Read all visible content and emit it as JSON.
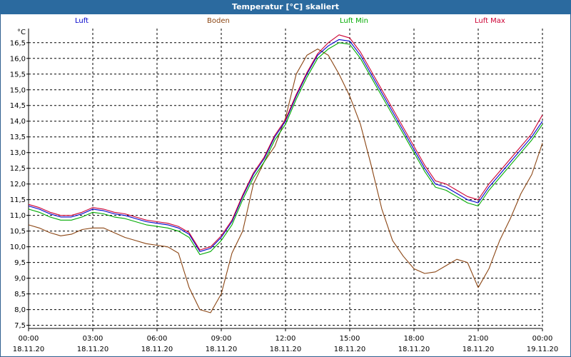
{
  "chart_data": {
    "type": "line",
    "title": "Temperatur [°C] skaliert",
    "ylabel": "°C",
    "ylim": [
      7.4,
      16.95
    ],
    "yticks": [
      "7,5",
      "8,0",
      "8,5",
      "9,0",
      "9,5",
      "10,0",
      "10,5",
      "11,0",
      "11,5",
      "12,0",
      "12,5",
      "13,0",
      "13,5",
      "14,0",
      "14,5",
      "15,0",
      "15,5",
      "16,0",
      "16,5"
    ],
    "xticks": [
      {
        "time": "00:00",
        "date": "18.11.20"
      },
      {
        "time": "03:00",
        "date": "18.11.20"
      },
      {
        "time": "06:00",
        "date": "18.11.20"
      },
      {
        "time": "09:00",
        "date": "18.11.20"
      },
      {
        "time": "12:00",
        "date": "18.11.20"
      },
      {
        "time": "15:00",
        "date": "18.11.20"
      },
      {
        "time": "18:00",
        "date": "18.11.20"
      },
      {
        "time": "21:00",
        "date": "18.11.20"
      },
      {
        "time": "00:00",
        "date": "19.11.20"
      }
    ],
    "x_hours": [
      0,
      0.5,
      1,
      1.5,
      2,
      2.5,
      3,
      3.5,
      4,
      4.5,
      5,
      5.5,
      6,
      6.5,
      7,
      7.5,
      8,
      8.5,
      9,
      9.5,
      10,
      10.5,
      11,
      11.5,
      12,
      12.5,
      13,
      13.5,
      14,
      14.5,
      15,
      15.5,
      16,
      16.5,
      17,
      17.5,
      18,
      18.5,
      19,
      19.5,
      20,
      20.5,
      21,
      21.5,
      22,
      22.5,
      23,
      23.5,
      24
    ],
    "series": [
      {
        "name": "Luft",
        "color": "#0000cc",
        "values": [
          11.3,
          11.2,
          11.05,
          10.95,
          10.95,
          11.05,
          11.2,
          11.15,
          11.05,
          11.0,
          10.9,
          10.8,
          10.75,
          10.7,
          10.6,
          10.4,
          9.85,
          9.95,
          10.3,
          10.8,
          11.6,
          12.3,
          12.8,
          13.5,
          14.0,
          14.8,
          15.5,
          16.1,
          16.4,
          16.6,
          16.55,
          16.1,
          15.5,
          14.9,
          14.3,
          13.7,
          13.1,
          12.5,
          12.0,
          11.9,
          11.7,
          11.5,
          11.4,
          11.9,
          12.3,
          12.7,
          13.1,
          13.5,
          14.0
        ]
      },
      {
        "name": "Boden",
        "color": "#8b4513",
        "values": [
          10.7,
          10.6,
          10.45,
          10.35,
          10.4,
          10.55,
          10.6,
          10.6,
          10.45,
          10.3,
          10.2,
          10.1,
          10.05,
          10.0,
          9.8,
          8.7,
          8.0,
          7.9,
          8.5,
          9.8,
          10.5,
          12.0,
          12.7,
          13.2,
          14.1,
          15.5,
          16.1,
          16.3,
          16.1,
          15.5,
          14.8,
          13.9,
          12.6,
          11.2,
          10.2,
          9.7,
          9.3,
          9.15,
          9.2,
          9.4,
          9.6,
          9.5,
          8.7,
          9.3,
          10.2,
          10.9,
          11.7,
          12.3,
          13.3
        ]
      },
      {
        "name": "Luft Min",
        "color": "#00aa00",
        "values": [
          11.2,
          11.1,
          10.95,
          10.85,
          10.85,
          10.95,
          11.1,
          11.05,
          10.95,
          10.9,
          10.8,
          10.7,
          10.65,
          10.6,
          10.5,
          10.3,
          9.75,
          9.85,
          10.2,
          10.7,
          11.5,
          12.2,
          12.7,
          13.4,
          13.9,
          14.7,
          15.4,
          16.0,
          16.3,
          16.5,
          16.45,
          16.0,
          15.4,
          14.8,
          14.2,
          13.6,
          13.0,
          12.4,
          11.9,
          11.8,
          11.6,
          11.4,
          11.3,
          11.8,
          12.2,
          12.6,
          13.0,
          13.4,
          13.9
        ]
      },
      {
        "name": "Luft Max",
        "color": "#cc0033",
        "values": [
          11.35,
          11.25,
          11.1,
          11.0,
          11.0,
          11.1,
          11.25,
          11.2,
          11.1,
          11.05,
          10.95,
          10.85,
          10.8,
          10.75,
          10.65,
          10.45,
          9.9,
          10.0,
          10.35,
          10.85,
          11.65,
          12.35,
          12.85,
          13.55,
          14.05,
          14.85,
          15.55,
          16.15,
          16.5,
          16.75,
          16.65,
          16.2,
          15.6,
          15.0,
          14.4,
          13.8,
          13.2,
          12.6,
          12.1,
          12.0,
          11.8,
          11.6,
          11.5,
          12.0,
          12.4,
          12.8,
          13.2,
          13.6,
          14.2
        ]
      }
    ]
  }
}
